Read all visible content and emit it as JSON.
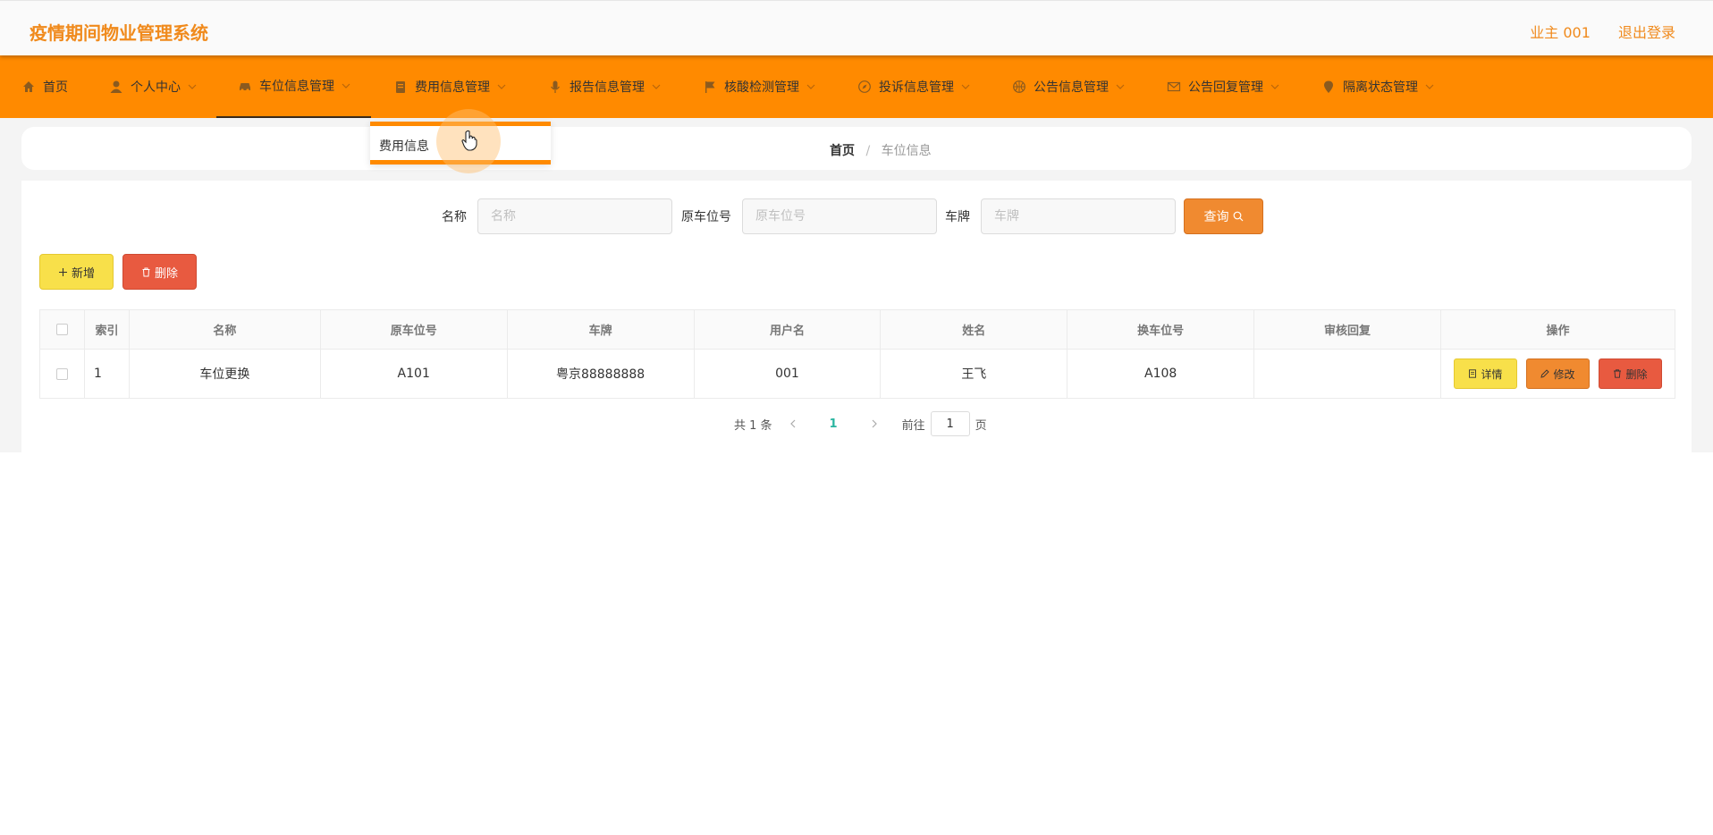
{
  "header": {
    "title": "疫情期间物业管理系统",
    "user_label": "业主 001",
    "logout_label": "退出登录"
  },
  "nav": {
    "items": [
      {
        "label": "首页",
        "icon": "home-icon"
      },
      {
        "label": "个人中心",
        "icon": "user-icon"
      },
      {
        "label": "车位信息管理",
        "icon": "car-icon"
      },
      {
        "label": "费用信息管理",
        "icon": "document-icon"
      },
      {
        "label": "报告信息管理",
        "icon": "microphone-icon"
      },
      {
        "label": "核酸检测管理",
        "icon": "flag-icon"
      },
      {
        "label": "投诉信息管理",
        "icon": "compass-icon"
      },
      {
        "label": "公告信息管理",
        "icon": "basketball-icon"
      },
      {
        "label": "公告回复管理",
        "icon": "mail-icon"
      },
      {
        "label": "隔离状态管理",
        "icon": "location-icon"
      }
    ],
    "active_index": 2,
    "dropdown_item": "费用信息"
  },
  "breadcrumb": {
    "home": "首页",
    "separator": "/",
    "current": "车位信息"
  },
  "search": {
    "name_label": "名称",
    "name_placeholder": "名称",
    "orig_slot_label": "原车位号",
    "orig_slot_placeholder": "原车位号",
    "plate_label": "车牌",
    "plate_placeholder": "车牌",
    "query_label": "查询"
  },
  "actions": {
    "add_label": "新增",
    "delete_label": "删除"
  },
  "table": {
    "columns": [
      "索引",
      "名称",
      "原车位号",
      "车牌",
      "用户名",
      "姓名",
      "换车位号",
      "审核回复",
      "操作"
    ],
    "rows": [
      {
        "index": "1",
        "name": "车位更换",
        "orig_slot": "A101",
        "plate": "粤京88888888",
        "username": "001",
        "realname": "王飞",
        "new_slot": "A108",
        "review": "",
        "ops": {
          "detail": "详情",
          "edit": "修改",
          "delete": "删除"
        }
      }
    ]
  },
  "pagination": {
    "total_text": "共 1 条",
    "current_page": "1",
    "goto_label": "前往",
    "goto_value": "1",
    "page_suffix": "页"
  },
  "colors": {
    "brand_orange": "#ff8a00",
    "title_orange": "#f08a1c",
    "yellow_button": "#f8e04a",
    "red_button": "#e85a40",
    "page_active": "#2ab5a0"
  }
}
